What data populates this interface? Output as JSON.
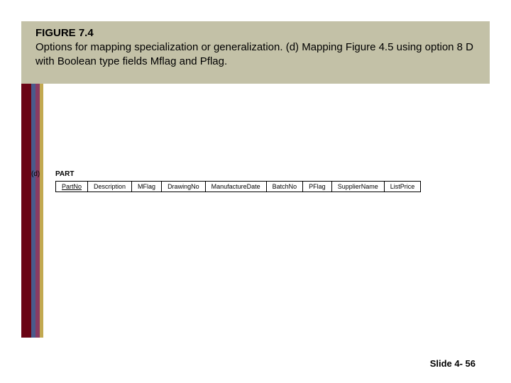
{
  "figure": {
    "number": "FIGURE 7.4",
    "caption": "Options for mapping specialization or generalization. (d) Mapping Figure 4.5 using option 8 D with Boolean type fields Mflag and Pflag."
  },
  "subfigure": {
    "label": "(d)",
    "relation_name": "PART",
    "columns": [
      "PartNo",
      "Description",
      "MFlag",
      "DrawingNo",
      "ManufactureDate",
      "BatchNo",
      "PFlag",
      "SupplierName",
      "ListPrice"
    ]
  },
  "footer": {
    "label": "Slide 4- 56"
  }
}
